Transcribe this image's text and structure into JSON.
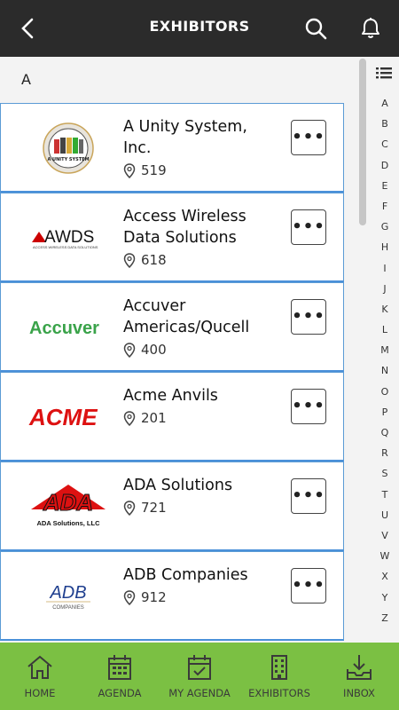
{
  "header": {
    "title": "EXHIBITORS"
  },
  "section_letter": "A",
  "exhibitors": [
    {
      "name": "A Unity System, Inc.",
      "booth": "519",
      "logo": "A UNITY SYSTEM"
    },
    {
      "name": "Access Wireless Data Solutions",
      "booth": "618",
      "logo": "AWDS"
    },
    {
      "name": "Accuver Americas/Qucell",
      "booth": "400",
      "logo": "Accuver"
    },
    {
      "name": "Acme Anvils",
      "booth": "201",
      "logo": "ACME"
    },
    {
      "name": "ADA Solutions",
      "booth": "721",
      "logo": "ADA"
    },
    {
      "name": "ADB Companies",
      "booth": "912",
      "logo": "ADB"
    }
  ],
  "logos": {
    "awds_sub": "ACCESS WIRELESS DATA SOLUTIONS",
    "ada_sub": "ADA Solutions, LLC",
    "adb_sub": "COMPANIES"
  },
  "more_label": "•••",
  "index_letters": [
    "A",
    "B",
    "C",
    "D",
    "E",
    "F",
    "G",
    "H",
    "I",
    "J",
    "K",
    "L",
    "M",
    "N",
    "O",
    "P",
    "Q",
    "R",
    "S",
    "T",
    "U",
    "V",
    "W",
    "X",
    "Y",
    "Z"
  ],
  "bottom_nav": [
    {
      "label": "HOME",
      "icon": "home-icon"
    },
    {
      "label": "AGENDA",
      "icon": "calendar-icon"
    },
    {
      "label": "MY AGENDA",
      "icon": "calendar-check-icon"
    },
    {
      "label": "EXHIBITORS",
      "icon": "building-icon"
    },
    {
      "label": "INBOX",
      "icon": "inbox-download-icon"
    }
  ],
  "colors": {
    "header": "#2b2b2b",
    "nav": "#7bc043",
    "row_border": "#4a90d9"
  }
}
